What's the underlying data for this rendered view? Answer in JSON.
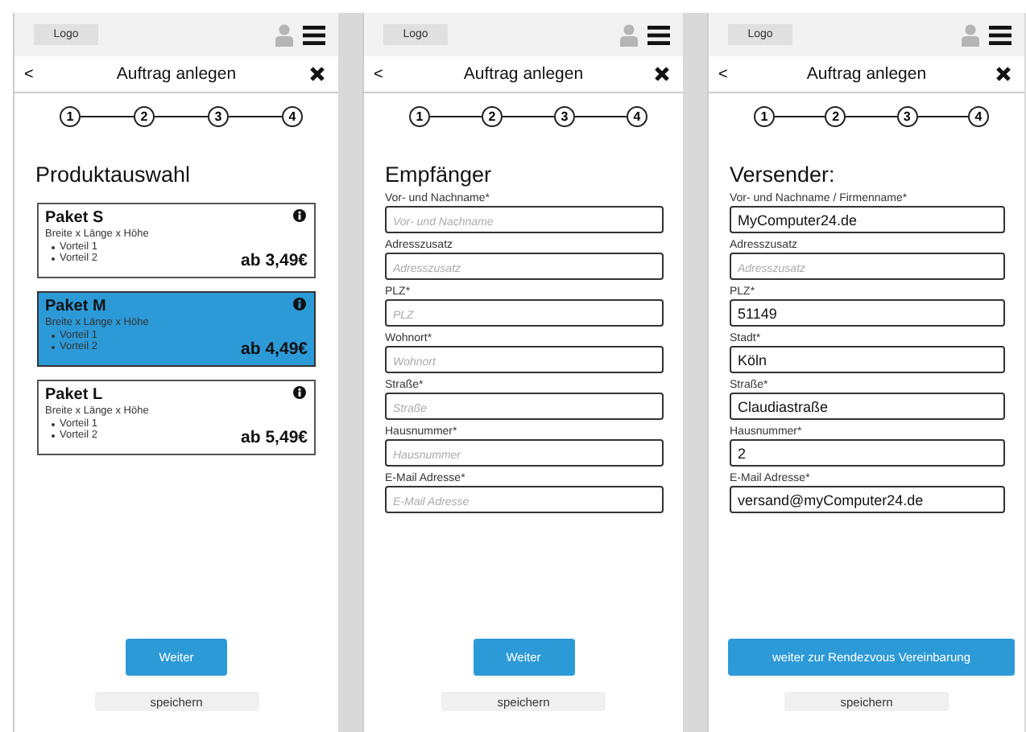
{
  "screens": [
    {
      "kind": "products",
      "logo": "Logo",
      "back": "<",
      "title": "Auftrag anlegen",
      "steps": [
        "1",
        "2",
        "3",
        "4"
      ],
      "heading": "Produktauswahl",
      "products": [
        {
          "name": "Paket S",
          "dimensions": "Breite x Länge x Höhe",
          "features": [
            "Vorteil 1",
            "Vorteil 2"
          ],
          "price": "ab 3,49€",
          "selected": false
        },
        {
          "name": "Paket M",
          "dimensions": "Breite x Länge x Höhe",
          "features": [
            "Vorteil 1",
            "Vorteil 2"
          ],
          "price": "ab 4,49€",
          "selected": true
        },
        {
          "name": "Paket L",
          "dimensions": "Breite x Länge x Höhe",
          "features": [
            "Vorteil 1",
            "Vorteil 2"
          ],
          "price": "ab 5,49€",
          "selected": false
        }
      ],
      "primary_button": "Weiter",
      "secondary_button": "speichern"
    },
    {
      "kind": "form",
      "logo": "Logo",
      "back": "<",
      "title": "Auftrag anlegen",
      "steps": [
        "1",
        "2",
        "3",
        "4"
      ],
      "heading": "Empfänger",
      "fields": [
        {
          "label": "Vor- und Nachname*",
          "placeholder": "Vor- und Nachname"
        },
        {
          "label": "Adresszusatz",
          "placeholder": "Adresszusatz"
        },
        {
          "label": "PLZ*",
          "placeholder": "PLZ"
        },
        {
          "label": "Wohnort*",
          "placeholder": "Wohnort"
        },
        {
          "label": "Straße*",
          "placeholder": "Straße"
        },
        {
          "label": "Hausnummer*",
          "placeholder": "Hausnummer"
        },
        {
          "label": "E-Mail Adresse*",
          "placeholder": "E-Mail Adresse"
        }
      ],
      "primary_button": "Weiter",
      "secondary_button": "speichern"
    },
    {
      "kind": "form",
      "logo": "Logo",
      "back": "<",
      "title": "Auftrag anlegen",
      "steps": [
        "1",
        "2",
        "3",
        "4"
      ],
      "heading": "Versender:",
      "fields": [
        {
          "label": "Vor- und Nachname / Firmenname*",
          "value": "MyComputer24.de"
        },
        {
          "label": "Adresszusatz",
          "placeholder": "Adresszusatz"
        },
        {
          "label": "PLZ*",
          "value": "51149"
        },
        {
          "label": "Stadt*",
          "value": "Köln"
        },
        {
          "label": "Straße*",
          "value": "Claudiastraße"
        },
        {
          "label": "Hausnummer*",
          "value": "2"
        },
        {
          "label": "E-Mail Adresse*",
          "value": "versand@myComputer24.de"
        }
      ],
      "primary_button": "weiter zur Rendezvous Vereinbarung",
      "secondary_button": "speichern"
    }
  ]
}
